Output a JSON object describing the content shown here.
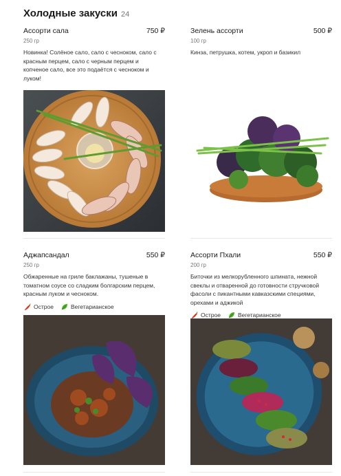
{
  "section": {
    "title": "Холодные закуски",
    "count": "24"
  },
  "items": [
    {
      "name": "Ассорти сала",
      "price": "750 ₽",
      "weight": "250 гр",
      "description": "Новинка! Солёное сало, сало с чесноком, сало с красным перцем, сало с черным перцем и копченое сало, все это подаётся с чесноком и луком!"
    },
    {
      "name": "Зелень ассорти",
      "price": "500 ₽",
      "weight": "100 гр",
      "description": "Кинза, петрушка, котем, укроп и базикил"
    },
    {
      "name": "Аджапсандал",
      "price": "550 ₽",
      "weight": "250 гр",
      "description": "Обжаренные на гриле баклажаны, тушеные в томатном соусе со сладким болгарским перцем, красным луком и чесноком.",
      "tags": {
        "spicy": "Острое",
        "vegetarian": "Вегетарианское"
      }
    },
    {
      "name": "Ассорти Пхали",
      "price": "550 ₽",
      "weight": "200 гр",
      "description": "Битoчки из мелкорубленного шпината, нежной свеклы и отваренной до готовности стручковой фасоли с пикантными кавказскими специями, орехами и аджикой",
      "tags": {
        "spicy": "Острое",
        "vegetarian": "Вегетарианское"
      }
    }
  ],
  "icons": {
    "spicy": "chili-pepper-icon",
    "vegetarian": "leaf-icon"
  },
  "colors": {
    "chili": "#d9341f",
    "leaf": "#4caf1f"
  }
}
